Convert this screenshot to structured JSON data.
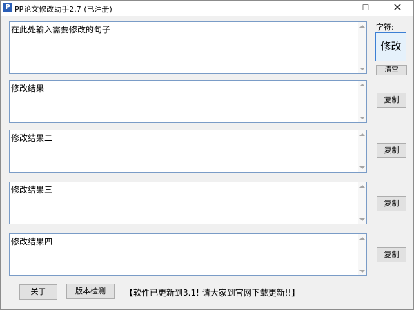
{
  "window": {
    "title": "PP论文修改助手2.7 (已注册)",
    "minimize_glyph": "—",
    "maximize_glyph": "☐",
    "close_glyph": "✕",
    "icon_letter": "P"
  },
  "input": {
    "text": "在此处输入需要修改的句子"
  },
  "side": {
    "char_label": "字符:",
    "modify_label": "修改",
    "clear_label": "清空"
  },
  "results": [
    {
      "label": "修改结果一",
      "copy_label": "复制"
    },
    {
      "label": "修改结果二",
      "copy_label": "复制"
    },
    {
      "label": "修改结果三",
      "copy_label": "复制"
    },
    {
      "label": "修改结果四",
      "copy_label": "复制"
    }
  ],
  "footer": {
    "about_label": "关于",
    "check_label": "版本检测",
    "notice": "【软件已更新到3.1! 请大家到官网下载更新!!】"
  },
  "colors": {
    "field_border": "#7a9cc7",
    "accent_button": "#3c7fd4",
    "window_bg": "#f0f0f0"
  }
}
